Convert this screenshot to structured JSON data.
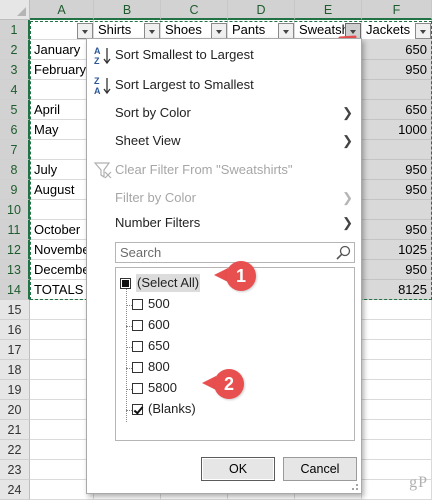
{
  "columns": [
    "A",
    "B",
    "C",
    "D",
    "E",
    "F"
  ],
  "rows": [
    "1",
    "2",
    "3",
    "4",
    "5",
    "6",
    "7",
    "8",
    "9",
    "10",
    "11",
    "12",
    "13",
    "14",
    "15",
    "16",
    "17",
    "18",
    "19",
    "20",
    "21",
    "22",
    "23",
    "24"
  ],
  "headers": {
    "shirts": "Shirts",
    "shoes": "Shoes",
    "pants": "Pants",
    "sweatshirts": "Sweatsh",
    "jackets": "Jackets"
  },
  "months": [
    "January",
    "February",
    "",
    "April",
    "May",
    "",
    "July",
    "August",
    "",
    "October",
    "November",
    "December",
    "TOTALS"
  ],
  "jackets": [
    "650",
    "950",
    "",
    "650",
    "1000",
    "",
    "950",
    "950",
    "",
    "950",
    "1025",
    "950",
    "8125"
  ],
  "menu": {
    "sort_asc": "Sort Smallest to Largest",
    "sort_desc": "Sort Largest to Smallest",
    "sort_by_color": "Sort by Color",
    "sheet_view": "Sheet View",
    "clear_filter": "Clear Filter From \"Sweatshirts\"",
    "filter_by_color": "Filter by Color",
    "number_filters": "Number Filters",
    "search_placeholder": "Search",
    "items": [
      {
        "label": "(Select All)",
        "state": "partial"
      },
      {
        "label": "500",
        "state": "unchecked"
      },
      {
        "label": "600",
        "state": "unchecked"
      },
      {
        "label": "650",
        "state": "unchecked"
      },
      {
        "label": "800",
        "state": "unchecked"
      },
      {
        "label": "5800",
        "state": "unchecked"
      },
      {
        "label": "(Blanks)",
        "state": "checked"
      }
    ],
    "ok": "OK",
    "cancel": "Cancel"
  },
  "callouts": [
    "1",
    "2"
  ],
  "watermark": "gP",
  "colors": {
    "callout": "#e84f4f",
    "selection": "#217346",
    "filtered_shade": "#d9d9d9"
  }
}
